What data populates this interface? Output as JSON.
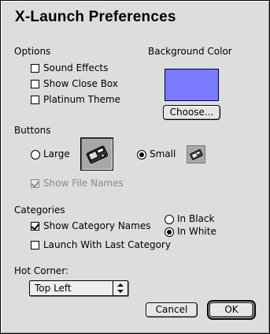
{
  "window": {
    "title": "X-Launch Preferences"
  },
  "options": {
    "heading": "Options",
    "sound_effects": {
      "label": "Sound Effects",
      "checked": false
    },
    "show_close_box": {
      "label": "Show Close Box",
      "checked": false
    },
    "platinum_theme": {
      "label": "Platinum Theme",
      "checked": false
    }
  },
  "background": {
    "heading": "Background Color",
    "color": "#7a7aff",
    "choose_label": "Choose..."
  },
  "buttons": {
    "heading": "Buttons",
    "large_label": "Large",
    "small_label": "Small",
    "selected": "Small",
    "large_icon": "launcher-large-icon",
    "small_icon": "launcher-small-icon",
    "show_file_names": {
      "label": "Show File Names",
      "checked": true,
      "enabled": false
    }
  },
  "categories": {
    "heading": "Categories",
    "show_category_names": {
      "label": "Show Category Names",
      "checked": true
    },
    "in_black": {
      "label": "In Black",
      "selected": false
    },
    "in_white": {
      "label": "In White",
      "selected": true
    },
    "launch_with_last": {
      "label": "Launch With Last Category",
      "checked": false
    }
  },
  "hot_corner": {
    "heading": "Hot Corner:",
    "value": "Top Left"
  },
  "footer": {
    "cancel_label": "Cancel",
    "ok_label": "OK"
  }
}
